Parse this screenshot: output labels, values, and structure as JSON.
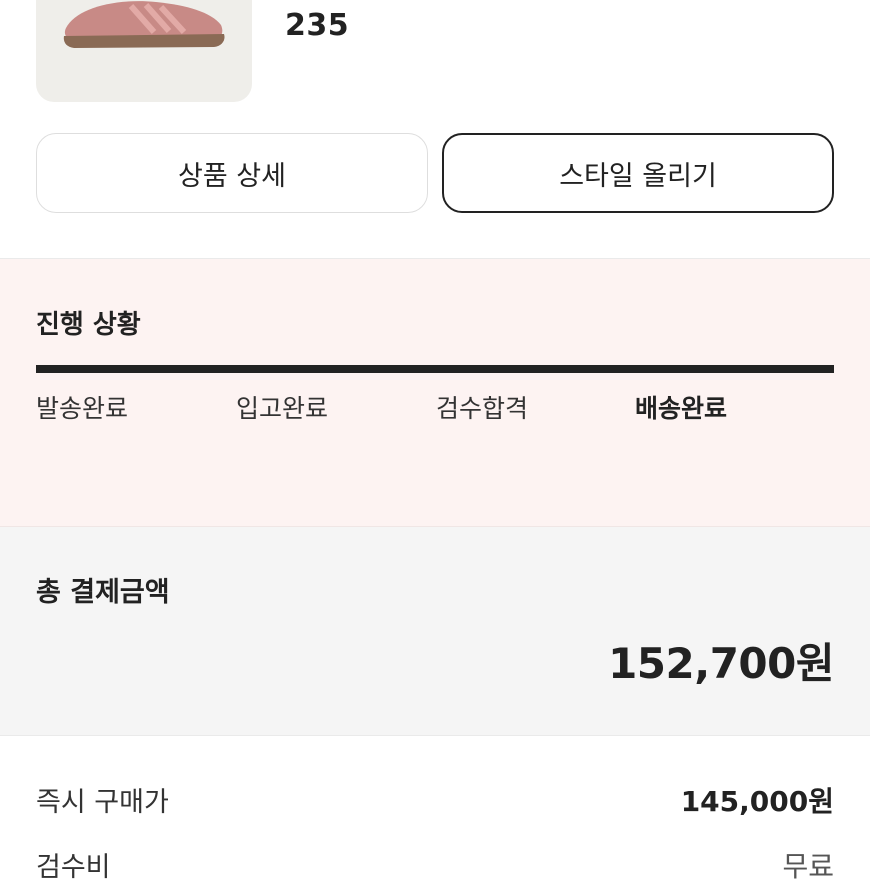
{
  "product": {
    "image_icon": "sneaker-image",
    "size": "235"
  },
  "actions": {
    "detail_label": "상품 상세",
    "style_label": "스타일 올리기"
  },
  "progress": {
    "title": "진행 상황",
    "completed_fraction": 1.0,
    "steps": [
      {
        "label": "발송완료",
        "active": false
      },
      {
        "label": "입고완료",
        "active": false
      },
      {
        "label": "검수합격",
        "active": false
      },
      {
        "label": "배송완료",
        "active": true
      }
    ]
  },
  "total": {
    "label": "총 결제금액",
    "amount": "152,700원"
  },
  "breakdown": [
    {
      "label": "즉시 구매가",
      "value": "145,000원"
    },
    {
      "label": "검수비",
      "value": "무료"
    }
  ],
  "colors": {
    "progress_bg": "#fdf3f2",
    "total_bg": "#f5f5f5",
    "accent": "#222222"
  }
}
